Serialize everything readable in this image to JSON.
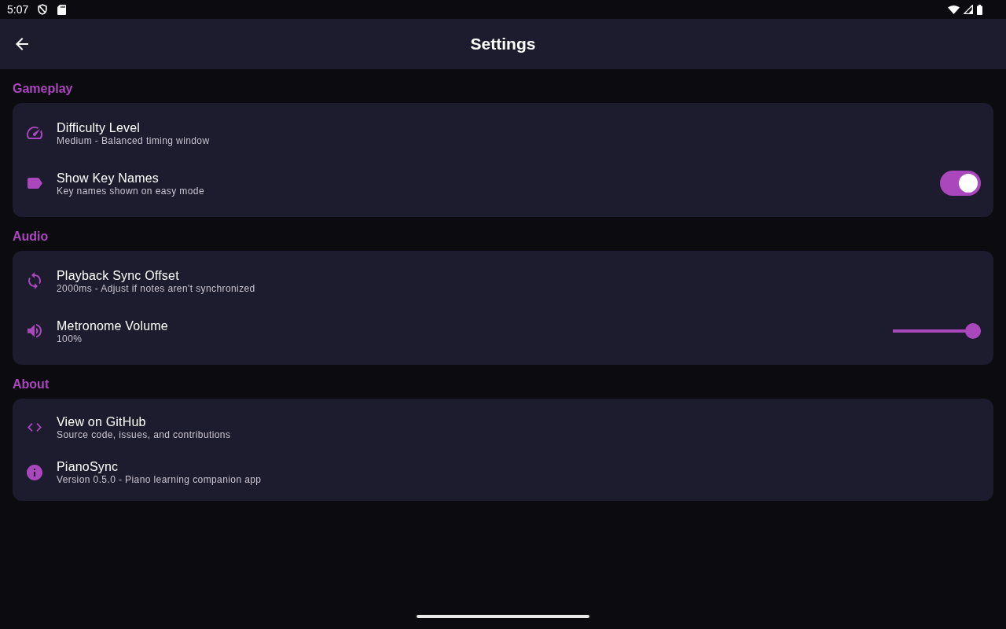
{
  "status_bar": {
    "time": "5:07"
  },
  "app_bar": {
    "title": "Settings"
  },
  "sections": [
    {
      "title": "Gameplay",
      "items": [
        {
          "kind": "plain",
          "title": "Difficulty Level",
          "subtitle": "Medium - Balanced timing window"
        },
        {
          "kind": "toggle",
          "title": "Show Key Names",
          "subtitle": "Key names shown on easy mode",
          "on": true
        }
      ]
    },
    {
      "title": "Audio",
      "items": [
        {
          "kind": "plain",
          "title": "Playback Sync Offset",
          "subtitle": "2000ms - Adjust if notes aren't synchronized"
        },
        {
          "kind": "slider",
          "title": "Metronome Volume",
          "subtitle": "100%",
          "level": 1
        }
      ]
    },
    {
      "title": "About",
      "items": [
        {
          "kind": "plain",
          "title": "View on GitHub",
          "subtitle": "Source code, issues, and contributions"
        },
        {
          "kind": "plain",
          "title": "PianoSync",
          "subtitle": "Version 0.5.0 - Piano learning companion app"
        }
      ]
    }
  ]
}
